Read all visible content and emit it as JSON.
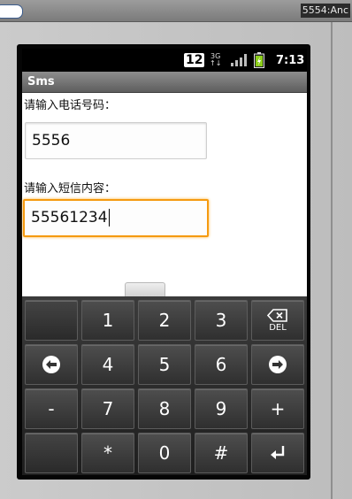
{
  "host": {
    "window_title": "5554:Anc"
  },
  "status_bar": {
    "notification_count": "12",
    "network_label_top": "3G",
    "network_label_bottom": "↑↓",
    "time": "7:13"
  },
  "app": {
    "title": "Sms",
    "phone_label": "请输入电话号码：",
    "phone_value": "5556",
    "message_label": "请输入短信内容：",
    "message_value": "55561234"
  },
  "keypad": {
    "rows": [
      [
        "",
        "1",
        "2",
        "3",
        "DEL"
      ],
      [
        "left-arrow",
        "4",
        "5",
        "6",
        "right-arrow"
      ],
      [
        "-",
        "7",
        "8",
        "9",
        "+"
      ],
      [
        "",
        "*",
        "0",
        "#",
        "enter"
      ]
    ],
    "del_label": "DEL",
    "minus": "-",
    "plus": "+",
    "star": "*",
    "hash": "#",
    "digits": {
      "d0": "0",
      "d1": "1",
      "d2": "2",
      "d3": "3",
      "d4": "4",
      "d5": "5",
      "d6": "6",
      "d7": "7",
      "d8": "8",
      "d9": "9"
    }
  },
  "colors": {
    "focus_border": "#f59a10",
    "battery_green": "#8ccf1a"
  }
}
